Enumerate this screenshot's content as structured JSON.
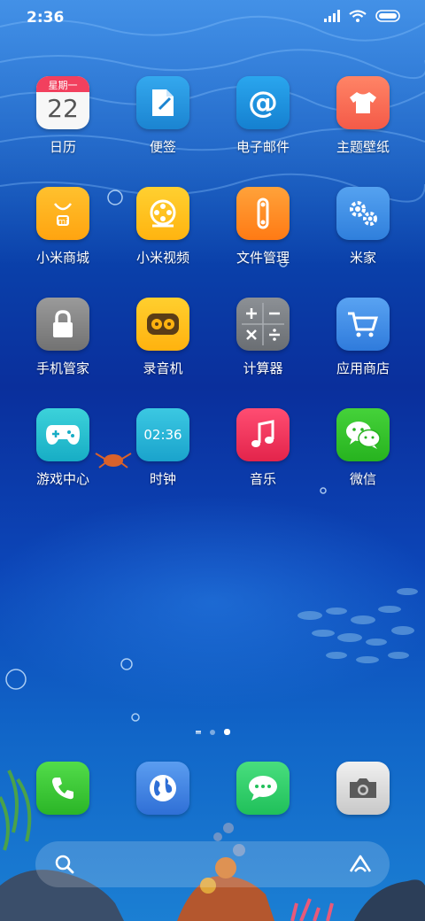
{
  "status_bar": {
    "time": "2:36"
  },
  "calendar": {
    "weekday": "星期一",
    "day": "22"
  },
  "clock_widget": {
    "time": "02:36"
  },
  "apps": [
    {
      "id": "calendar",
      "label": "日历",
      "color": "#ffffff",
      "icon": "calendar-icon"
    },
    {
      "id": "notes",
      "label": "便签",
      "color": "#1e8fd8",
      "icon": "notes-icon"
    },
    {
      "id": "email",
      "label": "电子邮件",
      "color": "#1c8fd9",
      "icon": "at-icon"
    },
    {
      "id": "themes",
      "label": "主题壁纸",
      "color": "#ff7057",
      "icon": "shirt-icon"
    },
    {
      "id": "mi-store",
      "label": "小米商城",
      "color": "#ffb31a",
      "icon": "shopping-bag-icon"
    },
    {
      "id": "mi-video",
      "label": "小米视频",
      "color": "#ffc21c",
      "icon": "film-reel-icon"
    },
    {
      "id": "file-manager",
      "label": "文件管理",
      "color": "#ff8a1e",
      "icon": "folder-clip-icon"
    },
    {
      "id": "mi-home",
      "label": "米家",
      "color": "#3f8fe6",
      "icon": "gears-icon"
    },
    {
      "id": "security",
      "label": "手机管家",
      "color": "#8a8a8a",
      "icon": "lock-icon"
    },
    {
      "id": "recorder",
      "label": "录音机",
      "color": "#ffc219",
      "icon": "cassette-icon"
    },
    {
      "id": "calculator",
      "label": "计算器",
      "color": "#7b7f85",
      "icon": "calculator-icon"
    },
    {
      "id": "app-store",
      "label": "应用商店",
      "color": "#3d8ee8",
      "icon": "cart-icon"
    },
    {
      "id": "game-center",
      "label": "游戏中心",
      "color": "#2ac2cf",
      "icon": "gamepad-icon"
    },
    {
      "id": "clock",
      "label": "时钟",
      "color": "#23b6d5",
      "icon": "clock-icon"
    },
    {
      "id": "music",
      "label": "音乐",
      "color": "#f0345a",
      "icon": "music-note-icon"
    },
    {
      "id": "wechat",
      "label": "微信",
      "color": "#35c42b",
      "icon": "wechat-icon"
    }
  ],
  "dock": [
    {
      "id": "phone",
      "color": "#3ccc3a",
      "icon": "phone-icon"
    },
    {
      "id": "browser",
      "color": "#3c7fe0",
      "icon": "globe-icon"
    },
    {
      "id": "messages",
      "color": "#2fd068",
      "icon": "message-bubble-icon"
    },
    {
      "id": "camera",
      "color": "#d9d9d9",
      "icon": "camera-icon"
    }
  ],
  "pages": {
    "count": 3,
    "active": 2
  }
}
